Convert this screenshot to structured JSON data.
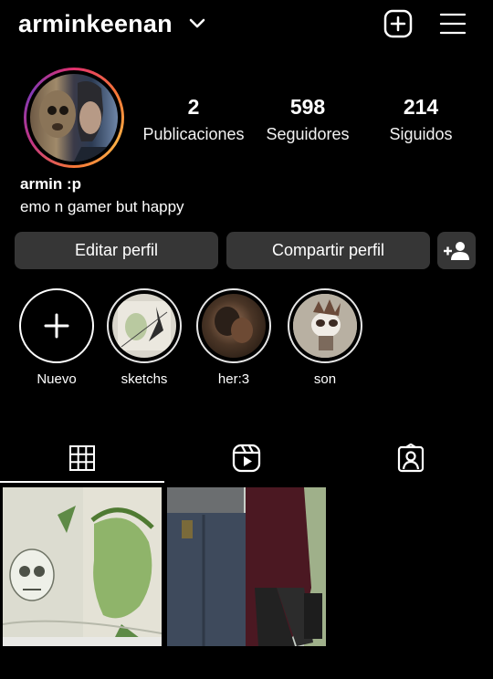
{
  "header": {
    "username": "arminkeenan",
    "icons": [
      "chevron-down-icon",
      "new-post-icon",
      "menu-icon"
    ]
  },
  "profile": {
    "display_name": "armin :p",
    "bio": "emo n gamer but happy",
    "stats": [
      {
        "value": "2",
        "label": "Publicaciones"
      },
      {
        "value": "598",
        "label": "Seguidores"
      },
      {
        "value": "214",
        "label": "Siguidos"
      }
    ]
  },
  "actions": {
    "edit_label": "Editar perfil",
    "share_label": "Compartir perfil",
    "discover_icon": "add-person-icon"
  },
  "highlights": [
    {
      "label": "Nuevo"
    },
    {
      "label": "sketchs"
    },
    {
      "label": "her:3"
    },
    {
      "label": "son"
    }
  ],
  "tabs": [
    {
      "icon": "grid-icon",
      "active": true
    },
    {
      "icon": "reels-icon",
      "active": false
    },
    {
      "icon": "tagged-icon",
      "active": false
    }
  ],
  "posts": [
    {
      "icon": "sketch-post"
    },
    {
      "icon": "photo-post"
    }
  ],
  "colors": {
    "background": "#000000",
    "button": "#363636",
    "text": "#ffffff",
    "story_ring": [
      "#e1306c",
      "#f77737",
      "#fcaf45",
      "#c13584",
      "#833ab4"
    ]
  }
}
